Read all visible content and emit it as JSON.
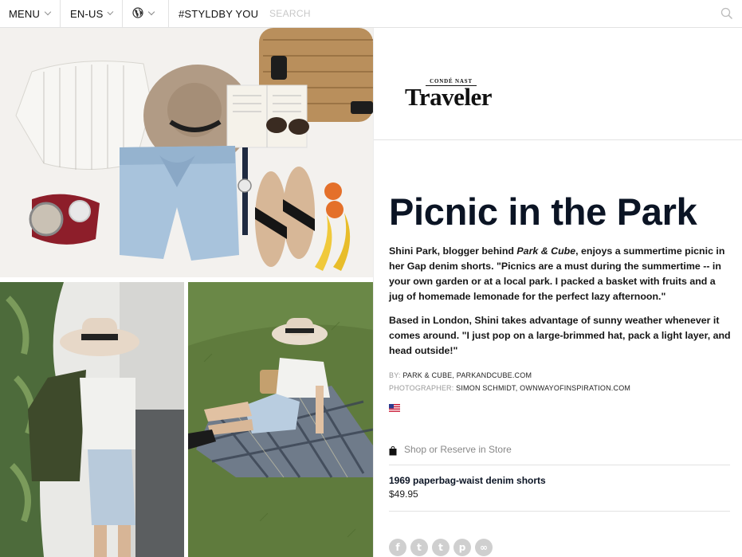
{
  "nav": {
    "menu_label": "MENU",
    "lang_label": "EN-US",
    "globe_icon": "globe-icon",
    "styldby_label": "#STYLDBY YOU",
    "search_placeholder": "SEARCH"
  },
  "logo": {
    "top": "CONDÉ NAST",
    "main": "Traveler"
  },
  "article": {
    "title": "Picnic in the Park",
    "p1_a": "Shini Park, blogger behind ",
    "p1_em": "Park & Cube",
    "p1_b": ", enjoys a summertime picnic in her Gap denim shorts. \"Picnics are a must during the summertime -- in your own garden or at a local park. I packed a basket with fruits and a jug of homemade lemonade for the perfect lazy afternoon.\"",
    "p2": "Based in London, Shini takes advantage of sunny weather whenever it comes around. \"I just pop on a large-brimmed hat, pack a light layer, and head outside!\""
  },
  "credits": {
    "by_label": "BY:",
    "by_name": "PARK & CUBE",
    "by_site": "PARKANDCUBE.COM",
    "photo_label": "PHOTOGRAPHER:",
    "photo_name": "SIMON SCHMIDT",
    "photo_site": "OWNWAYOFINSPIRATION.COM"
  },
  "shop": {
    "label": "Shop or Reserve in Store"
  },
  "product": {
    "name": "1969 paperbag-waist denim shorts",
    "price": "$49.95"
  },
  "social": {
    "facebook": "f",
    "twitter": "t",
    "tumblr": "t",
    "pinterest": "p",
    "link": "∞"
  },
  "colors": {
    "title": "#0b1424",
    "social_grey": "#cfcfcf",
    "divider": "#e2e2e2"
  }
}
